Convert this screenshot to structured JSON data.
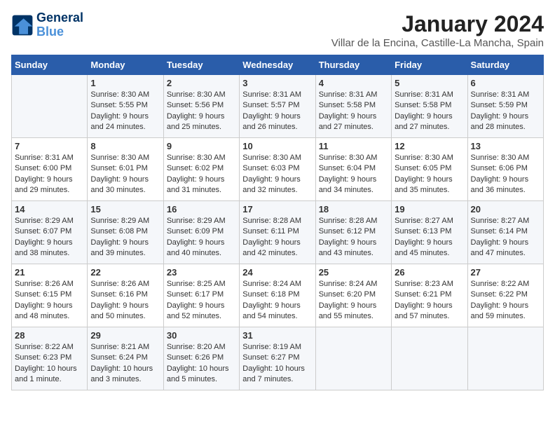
{
  "logo": {
    "line1": "General",
    "line2": "Blue"
  },
  "title": "January 2024",
  "subtitle": "Villar de la Encina, Castille-La Mancha, Spain",
  "days_of_week": [
    "Sunday",
    "Monday",
    "Tuesday",
    "Wednesday",
    "Thursday",
    "Friday",
    "Saturday"
  ],
  "weeks": [
    [
      {
        "day": "",
        "content": ""
      },
      {
        "day": "1",
        "content": "Sunrise: 8:30 AM\nSunset: 5:55 PM\nDaylight: 9 hours\nand 24 minutes."
      },
      {
        "day": "2",
        "content": "Sunrise: 8:30 AM\nSunset: 5:56 PM\nDaylight: 9 hours\nand 25 minutes."
      },
      {
        "day": "3",
        "content": "Sunrise: 8:31 AM\nSunset: 5:57 PM\nDaylight: 9 hours\nand 26 minutes."
      },
      {
        "day": "4",
        "content": "Sunrise: 8:31 AM\nSunset: 5:58 PM\nDaylight: 9 hours\nand 27 minutes."
      },
      {
        "day": "5",
        "content": "Sunrise: 8:31 AM\nSunset: 5:58 PM\nDaylight: 9 hours\nand 27 minutes."
      },
      {
        "day": "6",
        "content": "Sunrise: 8:31 AM\nSunset: 5:59 PM\nDaylight: 9 hours\nand 28 minutes."
      }
    ],
    [
      {
        "day": "7",
        "content": "Sunrise: 8:31 AM\nSunset: 6:00 PM\nDaylight: 9 hours\nand 29 minutes."
      },
      {
        "day": "8",
        "content": "Sunrise: 8:30 AM\nSunset: 6:01 PM\nDaylight: 9 hours\nand 30 minutes."
      },
      {
        "day": "9",
        "content": "Sunrise: 8:30 AM\nSunset: 6:02 PM\nDaylight: 9 hours\nand 31 minutes."
      },
      {
        "day": "10",
        "content": "Sunrise: 8:30 AM\nSunset: 6:03 PM\nDaylight: 9 hours\nand 32 minutes."
      },
      {
        "day": "11",
        "content": "Sunrise: 8:30 AM\nSunset: 6:04 PM\nDaylight: 9 hours\nand 34 minutes."
      },
      {
        "day": "12",
        "content": "Sunrise: 8:30 AM\nSunset: 6:05 PM\nDaylight: 9 hours\nand 35 minutes."
      },
      {
        "day": "13",
        "content": "Sunrise: 8:30 AM\nSunset: 6:06 PM\nDaylight: 9 hours\nand 36 minutes."
      }
    ],
    [
      {
        "day": "14",
        "content": "Sunrise: 8:29 AM\nSunset: 6:07 PM\nDaylight: 9 hours\nand 38 minutes."
      },
      {
        "day": "15",
        "content": "Sunrise: 8:29 AM\nSunset: 6:08 PM\nDaylight: 9 hours\nand 39 minutes."
      },
      {
        "day": "16",
        "content": "Sunrise: 8:29 AM\nSunset: 6:09 PM\nDaylight: 9 hours\nand 40 minutes."
      },
      {
        "day": "17",
        "content": "Sunrise: 8:28 AM\nSunset: 6:11 PM\nDaylight: 9 hours\nand 42 minutes."
      },
      {
        "day": "18",
        "content": "Sunrise: 8:28 AM\nSunset: 6:12 PM\nDaylight: 9 hours\nand 43 minutes."
      },
      {
        "day": "19",
        "content": "Sunrise: 8:27 AM\nSunset: 6:13 PM\nDaylight: 9 hours\nand 45 minutes."
      },
      {
        "day": "20",
        "content": "Sunrise: 8:27 AM\nSunset: 6:14 PM\nDaylight: 9 hours\nand 47 minutes."
      }
    ],
    [
      {
        "day": "21",
        "content": "Sunrise: 8:26 AM\nSunset: 6:15 PM\nDaylight: 9 hours\nand 48 minutes."
      },
      {
        "day": "22",
        "content": "Sunrise: 8:26 AM\nSunset: 6:16 PM\nDaylight: 9 hours\nand 50 minutes."
      },
      {
        "day": "23",
        "content": "Sunrise: 8:25 AM\nSunset: 6:17 PM\nDaylight: 9 hours\nand 52 minutes."
      },
      {
        "day": "24",
        "content": "Sunrise: 8:24 AM\nSunset: 6:18 PM\nDaylight: 9 hours\nand 54 minutes."
      },
      {
        "day": "25",
        "content": "Sunrise: 8:24 AM\nSunset: 6:20 PM\nDaylight: 9 hours\nand 55 minutes."
      },
      {
        "day": "26",
        "content": "Sunrise: 8:23 AM\nSunset: 6:21 PM\nDaylight: 9 hours\nand 57 minutes."
      },
      {
        "day": "27",
        "content": "Sunrise: 8:22 AM\nSunset: 6:22 PM\nDaylight: 9 hours\nand 59 minutes."
      }
    ],
    [
      {
        "day": "28",
        "content": "Sunrise: 8:22 AM\nSunset: 6:23 PM\nDaylight: 10 hours\nand 1 minute."
      },
      {
        "day": "29",
        "content": "Sunrise: 8:21 AM\nSunset: 6:24 PM\nDaylight: 10 hours\nand 3 minutes."
      },
      {
        "day": "30",
        "content": "Sunrise: 8:20 AM\nSunset: 6:26 PM\nDaylight: 10 hours\nand 5 minutes."
      },
      {
        "day": "31",
        "content": "Sunrise: 8:19 AM\nSunset: 6:27 PM\nDaylight: 10 hours\nand 7 minutes."
      },
      {
        "day": "",
        "content": ""
      },
      {
        "day": "",
        "content": ""
      },
      {
        "day": "",
        "content": ""
      }
    ]
  ]
}
